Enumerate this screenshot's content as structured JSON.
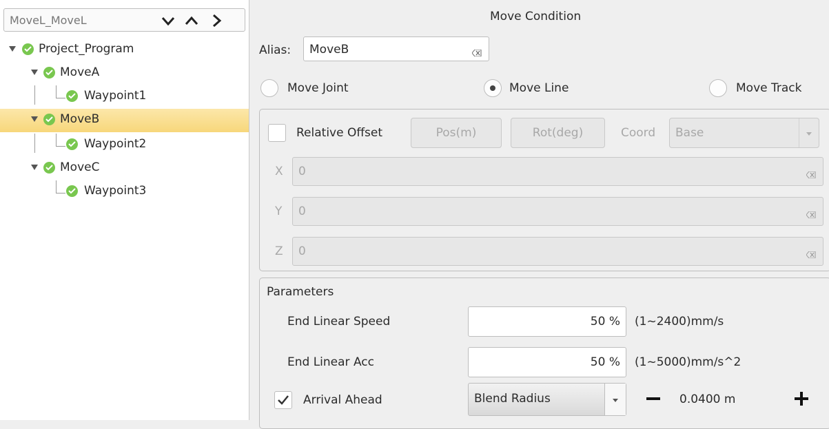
{
  "tree": {
    "header_title": "MoveL_MoveL",
    "items": [
      {
        "label": "Project_Program",
        "level": 0,
        "expanded": true
      },
      {
        "label": "MoveA",
        "level": 1,
        "expanded": true
      },
      {
        "label": "Waypoint1",
        "level": 2
      },
      {
        "label": "MoveB",
        "level": 1,
        "expanded": true,
        "selected": true
      },
      {
        "label": "Waypoint2",
        "level": 2
      },
      {
        "label": "MoveC",
        "level": 1,
        "expanded": true
      },
      {
        "label": "Waypoint3",
        "level": 2
      }
    ]
  },
  "move_condition": {
    "title": "Move Condition",
    "alias_label": "Alias:",
    "alias_value": "MoveB",
    "move_types": [
      {
        "label": "Move Joint",
        "selected": false
      },
      {
        "label": "Move Line",
        "selected": true
      },
      {
        "label": "Move Track",
        "selected": false
      }
    ]
  },
  "offset": {
    "checkbox_label": "Relative Offset",
    "checked": false,
    "pos_button": "Pos(m)",
    "rot_button": "Rot(deg)",
    "coord_label": "Coord",
    "coord_value": "Base",
    "axes": [
      {
        "label": "X",
        "value": "0"
      },
      {
        "label": "Y",
        "value": "0"
      },
      {
        "label": "Z",
        "value": "0"
      }
    ]
  },
  "parameters": {
    "title": "Parameters",
    "end_linear_speed": {
      "label": "End Linear Speed",
      "value": "50 %",
      "range": "(1~2400)mm/s"
    },
    "end_linear_acc": {
      "label": "End Linear Acc",
      "value": "50 %",
      "range": "(1~5000)mm/s^2"
    },
    "arrival_ahead": {
      "label": "Arrival Ahead",
      "checked": true,
      "mode": "Blend Radius",
      "value": "0.0400 m"
    }
  },
  "colors": {
    "selection": "#f7d77b",
    "check_green": "#79c74f"
  }
}
